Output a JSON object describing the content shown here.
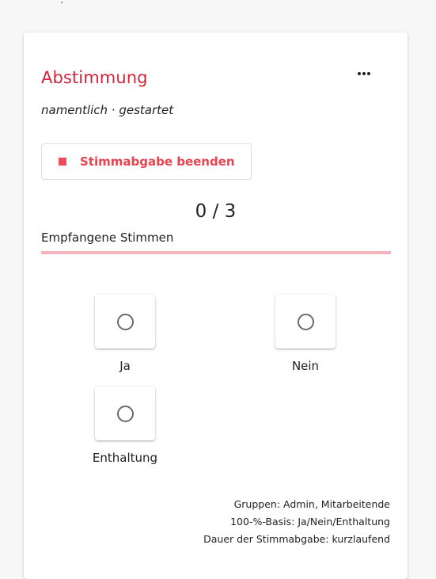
{
  "poll": {
    "title": "Abstimmung",
    "subtitle": "namentlich · gestartet",
    "stop_button_label": "Stimmabgabe beenden",
    "count_text": "0 / 3",
    "received_label": "Empfangene Stimmen",
    "progress_fraction": 0
  },
  "options": [
    {
      "label": "Ja"
    },
    {
      "label": "Nein"
    },
    {
      "label": "Enthaltung"
    }
  ],
  "meta": {
    "groups": "Gruppen: Admin, Mitarbeitende",
    "base": "100-%-Basis: Ja/Nein/Enthaltung",
    "duration": "Dauer der Stimmabgabe: kurzlaufend"
  },
  "icons": {
    "more": "more-horizontal-icon",
    "stop": "stop-square-icon",
    "radio": "radio-unchecked-icon"
  },
  "colors": {
    "accent": "#d6233a",
    "stop_red": "#ee4c5c",
    "progress_track": "#f3b5bb"
  }
}
